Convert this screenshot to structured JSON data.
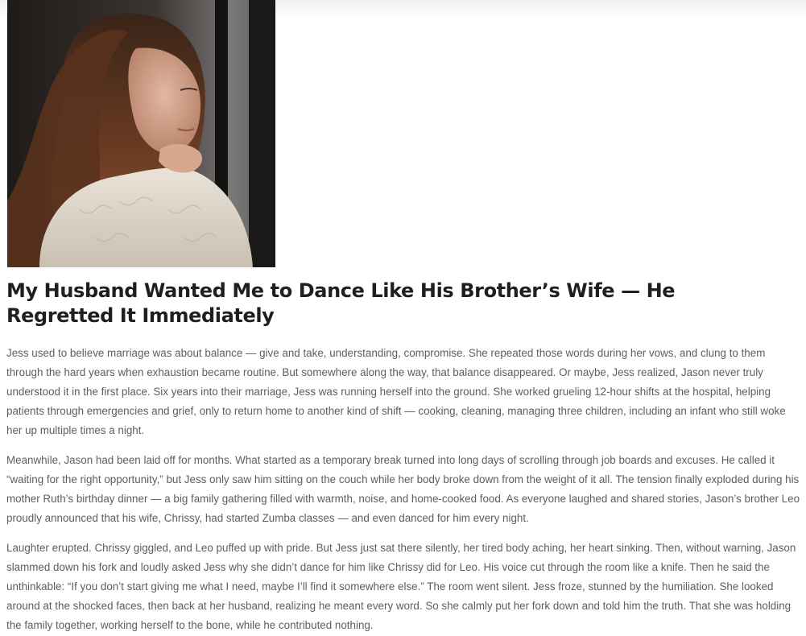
{
  "article": {
    "image_alt": "Woman with long auburn hair in a cream knit sweater gazing out a window, chin resting on her hand",
    "title": "My Husband Wanted Me to Dance Like His Brother’s Wife — He Regretted It Immediately",
    "paragraphs": [
      "Jess used to believe marriage was about balance — give and take, understanding, compromise. She repeated those words during her vows, and clung to them through the hard years when exhaustion became routine. But somewhere along the way, that balance disappeared. Or maybe, Jess realized, Jason never truly understood it in the first place. Six years into their marriage, Jess was running herself into the ground. She worked grueling 12-hour shifts at the hospital, helping patients through emergencies and grief, only to return home to another kind of shift — cooking, cleaning, managing three children, including an infant who still woke her up multiple times a night.",
      "Meanwhile, Jason had been laid off for months. What started as a temporary break turned into long days of scrolling through job boards and excuses. He called it “waiting for the right opportunity,” but Jess only saw him sitting on the couch while her body broke down from the weight of it all. The tension finally exploded during his mother Ruth’s birthday dinner — a big family gathering filled with warmth, noise, and home-cooked food. As everyone laughed and shared stories, Jason’s brother Leo proudly announced that his wife, Chrissy, had started Zumba classes — and even danced for him every night.",
      "Laughter erupted. Chrissy giggled, and Leo puffed up with pride. But Jess just sat there silently, her tired body aching, her heart sinking. Then, without warning, Jason slammed down his fork and loudly asked Jess why she didn’t dance for him like Chrissy did for Leo. His voice cut through the room like a knife. Then he said the unthinkable: “If you don’t start giving me what I need, maybe I’ll find it somewhere else.” The room went silent. Jess froze, stunned by the humiliation. She looked around at the shocked faces, then back at her husband, realizing he meant every word. So she calmly put her fork down and told him the truth. That she was holding the family together, working herself to the bone, while he contributed nothing."
    ]
  }
}
